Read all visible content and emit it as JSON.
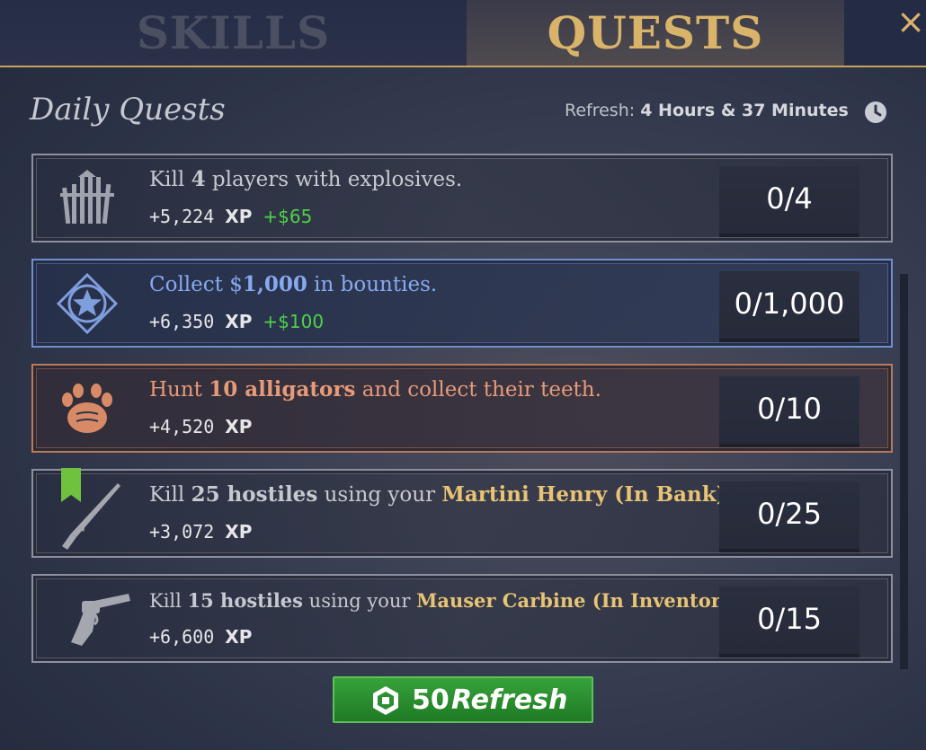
{
  "tabs": [
    {
      "label": "SKILLS",
      "active": false
    },
    {
      "label": "QUESTS",
      "active": true
    }
  ],
  "close_icon": "×",
  "header": {
    "title": "Daily Quests",
    "refresh_label": "Refresh:",
    "refresh_time": "4 Hours & 37 Minutes",
    "clock_icon": "clock-icon"
  },
  "quests": [
    {
      "icon": "fence-explosives-icon",
      "accent": "#8d909e",
      "text_parts": [
        "Kill ",
        "4",
        " players with explosives."
      ],
      "xp": "+5,224",
      "xp_label": "XP",
      "money": "+$65",
      "progress": "0/4"
    },
    {
      "icon": "sheriff-star-badge-icon",
      "accent": "#6f8fd0",
      "text_color": "#86a9f0",
      "text_parts": [
        "Collect $",
        "1,000",
        " in bounties."
      ],
      "xp": "+6,350",
      "xp_label": "XP",
      "money": "+$100",
      "progress": "0/1,000"
    },
    {
      "icon": "claw-paw-icon",
      "accent": "#b87a5c",
      "text_color": "#e69a78",
      "text_parts": [
        "Hunt ",
        "10 alligators",
        " and collect their teeth."
      ],
      "xp": "+4,520",
      "xp_label": "XP",
      "money": "",
      "progress": "0/10"
    },
    {
      "icon": "rifle-icon",
      "accent": "#8d909e",
      "text_parts": [
        "Kill ",
        "25 hostiles",
        " using your ",
        "Martini Henry (In Bank)",
        "."
      ],
      "xp": "+3,072",
      "xp_label": "XP",
      "money": "",
      "progress": "0/25",
      "bookmark": true
    },
    {
      "icon": "revolver-icon",
      "accent": "#8d909e",
      "text_parts": [
        "Kill ",
        "15 hostiles",
        " using your ",
        "Mauser Carbine (In Inventory)",
        "."
      ],
      "xp": "+6,600",
      "xp_label": "XP",
      "money": "",
      "progress": "0/15"
    }
  ],
  "refresh_button": {
    "icon": "robux-icon",
    "cost": "50",
    "label": "Refresh"
  },
  "colors": {
    "gold": "#d9b36a",
    "highlight_gold": "#e8c374",
    "money_green": "#4ed14a",
    "button_green": "#2e8f32"
  }
}
